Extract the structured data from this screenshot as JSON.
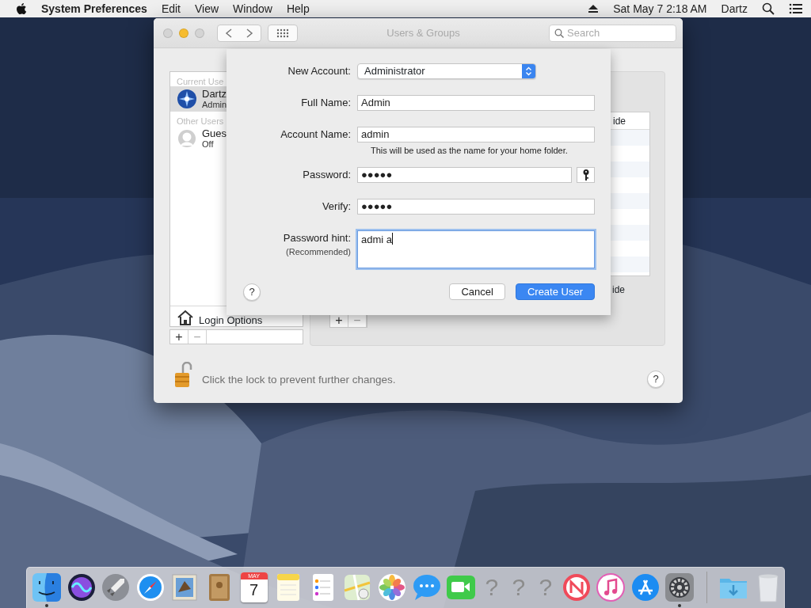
{
  "menu_bar": {
    "app": "System Preferences",
    "menus": [
      "Edit",
      "View",
      "Window",
      "Help"
    ],
    "clock": "Sat May 7  2:18 AM",
    "user": "Dartz"
  },
  "window": {
    "title": "Users & Groups",
    "search": {
      "placeholder": "Search"
    },
    "sidebar": {
      "sections": [
        {
          "heading": "Current Use",
          "users": [
            {
              "name": "Dartz",
              "role": "Admin",
              "selected": true
            }
          ]
        },
        {
          "heading": "Other Users",
          "users": [
            {
              "name": "Gues",
              "role": "Off",
              "kind": "silhouette",
              "selected": false
            }
          ]
        }
      ],
      "login_options": "Login Options",
      "buttons": [
        {
          "label": "+",
          "disabled": false
        },
        {
          "label": "−",
          "disabled": true
        }
      ]
    },
    "panel": {
      "column_header": "ide",
      "footer_text": "ide",
      "buttons": [
        {
          "label": "+",
          "disabled": false
        },
        {
          "label": "−",
          "disabled": true
        }
      ]
    },
    "lock": {
      "locked": false,
      "message": "Click the lock to prevent further changes."
    },
    "help": "?"
  },
  "sheet": {
    "fields": [
      {
        "kind": "popup",
        "label": "New Account:",
        "value": "Administrator"
      },
      {
        "kind": "text",
        "label": "Full Name:",
        "value": "Admin"
      },
      {
        "kind": "text",
        "label": "Account Name:",
        "value": "admin",
        "note": "This will be used as the name for your home folder."
      },
      {
        "kind": "password",
        "label": "Password:",
        "value": "●●●●●"
      },
      {
        "kind": "text",
        "label": "Verify:",
        "value": "●●●●●"
      },
      {
        "kind": "textarea",
        "label": "Password hint:",
        "sublabel": "(Recommended)",
        "value": "admi a",
        "focused": true
      }
    ],
    "help": "?",
    "buttons": [
      {
        "label": "Cancel",
        "default": false
      },
      {
        "label": "Create User",
        "default": true
      }
    ]
  },
  "dock": {
    "items": [
      {
        "kind": "finder",
        "running": true
      },
      {
        "kind": "siri",
        "running": false
      },
      {
        "kind": "launchpad",
        "running": false
      },
      {
        "kind": "safari",
        "running": false
      },
      {
        "kind": "mail",
        "running": false
      },
      {
        "kind": "contacts",
        "running": false
      },
      {
        "kind": "calendar",
        "month": "MAY",
        "day": "7",
        "running": false
      },
      {
        "kind": "notes",
        "running": false
      },
      {
        "kind": "reminders",
        "running": false
      },
      {
        "kind": "maps",
        "running": false
      },
      {
        "kind": "photos",
        "running": false
      },
      {
        "kind": "messages",
        "running": false
      },
      {
        "kind": "facetime",
        "running": false
      },
      {
        "kind": "missing",
        "label": "?",
        "running": false
      },
      {
        "kind": "missing",
        "label": "?",
        "running": false
      },
      {
        "kind": "missing",
        "label": "?",
        "running": false
      },
      {
        "kind": "news",
        "running": false
      },
      {
        "kind": "music",
        "running": false
      },
      {
        "kind": "appstore",
        "running": false
      },
      {
        "kind": "sysprefs",
        "running": true
      },
      {
        "kind": "separator"
      },
      {
        "kind": "downloads",
        "running": false
      },
      {
        "kind": "trash",
        "running": false
      }
    ]
  }
}
